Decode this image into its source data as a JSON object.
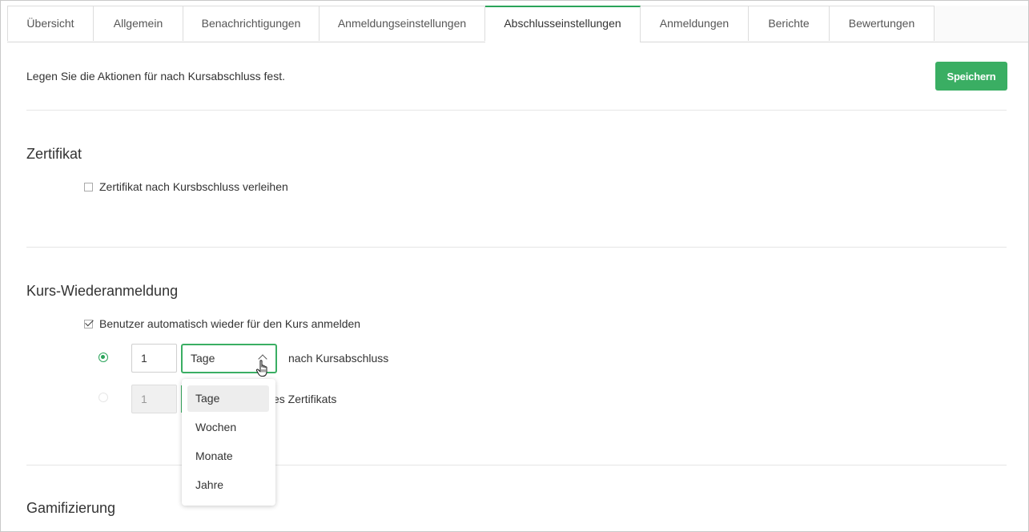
{
  "tabs": [
    {
      "label": "Übersicht"
    },
    {
      "label": "Allgemein"
    },
    {
      "label": "Benachrichtigungen"
    },
    {
      "label": "Anmeldungseinstellungen"
    },
    {
      "label": "Abschlusseinstellungen",
      "active": true
    },
    {
      "label": "Anmeldungen"
    },
    {
      "label": "Berichte"
    },
    {
      "label": "Bewertungen"
    }
  ],
  "intro_text": "Legen Sie die Aktionen für nach Kursabschluss fest.",
  "save_label": "Speichern",
  "accent_color": "#3aae63",
  "certificate": {
    "title": "Zertifikat",
    "checkbox_label": "Zertifikat nach Kursbschluss verleihen",
    "checked": false
  },
  "reenrollment": {
    "title": "Kurs-Wiederanmeldung",
    "checkbox_label": "Benutzer automatisch wieder für den Kurs anmelden",
    "checked": true,
    "option1": {
      "value": "1",
      "unit": "Tage",
      "after_text": "nach Kursabschluss",
      "selected": true
    },
    "option2": {
      "value": "1",
      "after_text": "es Zertifikats",
      "selected": false
    }
  },
  "unit_dropdown": {
    "options": [
      "Tage",
      "Wochen",
      "Monate",
      "Jahre"
    ],
    "highlighted": "Tage"
  },
  "gamification": {
    "title": "Gamifizierung"
  }
}
